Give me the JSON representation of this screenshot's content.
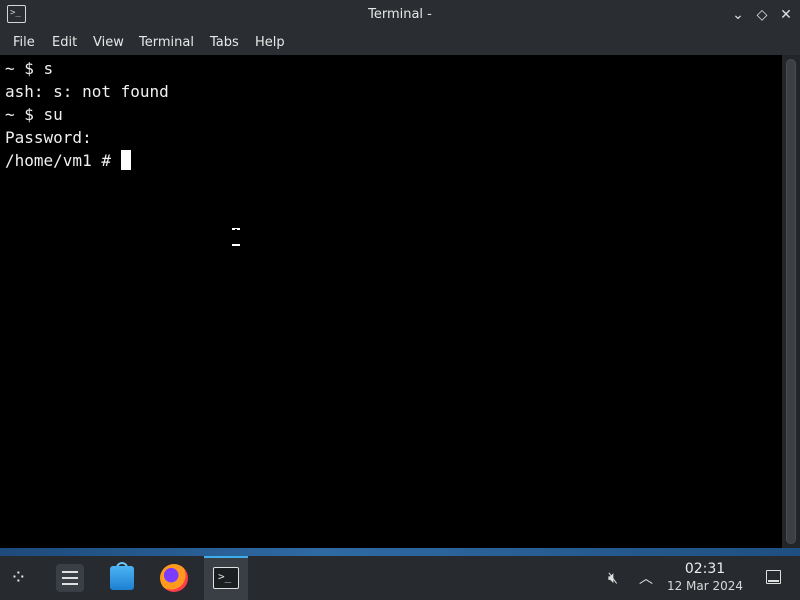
{
  "window": {
    "title": "Terminal -",
    "icon": "terminal-icon",
    "controls": {
      "minimize": "⌄",
      "maximize": "◇",
      "close": "✕"
    }
  },
  "menubar": {
    "items": [
      "File",
      "Edit",
      "View",
      "Terminal",
      "Tabs",
      "Help"
    ]
  },
  "terminal": {
    "lines": [
      "~ $ s",
      "ash: s: not found",
      "~ $ su",
      "Password:",
      "/home/vm1 # "
    ]
  },
  "panel": {
    "apps": [
      {
        "icon": "app-launcher-icon"
      },
      {
        "icon": "system-settings-icon"
      },
      {
        "icon": "discover-store-icon"
      },
      {
        "icon": "firefox-icon"
      },
      {
        "icon": "terminal-icon",
        "active": true
      }
    ],
    "tray": {
      "volume_icon": "speaker-muted-icon",
      "expand_icon": "chevron-up-icon"
    },
    "clock": {
      "time": "02:31",
      "date": "12 Mar 2024"
    }
  },
  "colors": {
    "accent": "#3daee9",
    "terminal_bg": "#000000",
    "panel_bg": "#272a2e"
  }
}
